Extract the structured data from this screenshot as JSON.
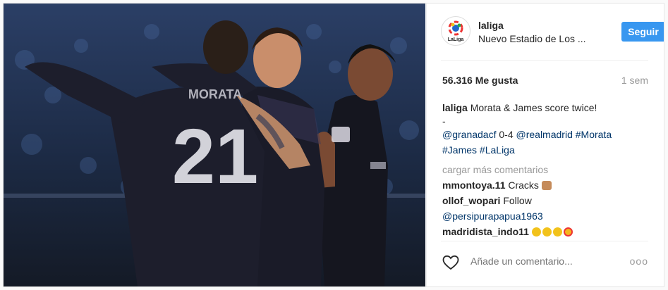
{
  "post": {
    "username": "laliga",
    "location": "Nuevo Estadio de Los ...",
    "follow_label": "Seguir",
    "likes": "56.316 Me gusta",
    "time": "1 sem",
    "caption": {
      "user": "laliga",
      "text": "Morata & James score twice!",
      "dash": "-",
      "mention1": "@granadacf",
      "score": " 0-4 ",
      "mention2": "@realmadrid",
      "tag1": "#Morata",
      "tag2": "#James",
      "tag3": "#LaLiga"
    },
    "load_more": "cargar más comentarios",
    "comments": [
      {
        "user": "mmontoya.11",
        "text": "Cracks"
      },
      {
        "user": "ollof_wopari",
        "text": "Follow",
        "mention": "@persipurapapua1963"
      },
      {
        "user": "madridista_indo11",
        "text": ""
      }
    ],
    "add_comment_placeholder": "Añade un comentario...",
    "more_options": "ooo",
    "player_number": "21",
    "avatar_text": "LaLiga",
    "icons": {
      "like": "heart-icon",
      "options": "more-options-icon"
    }
  }
}
